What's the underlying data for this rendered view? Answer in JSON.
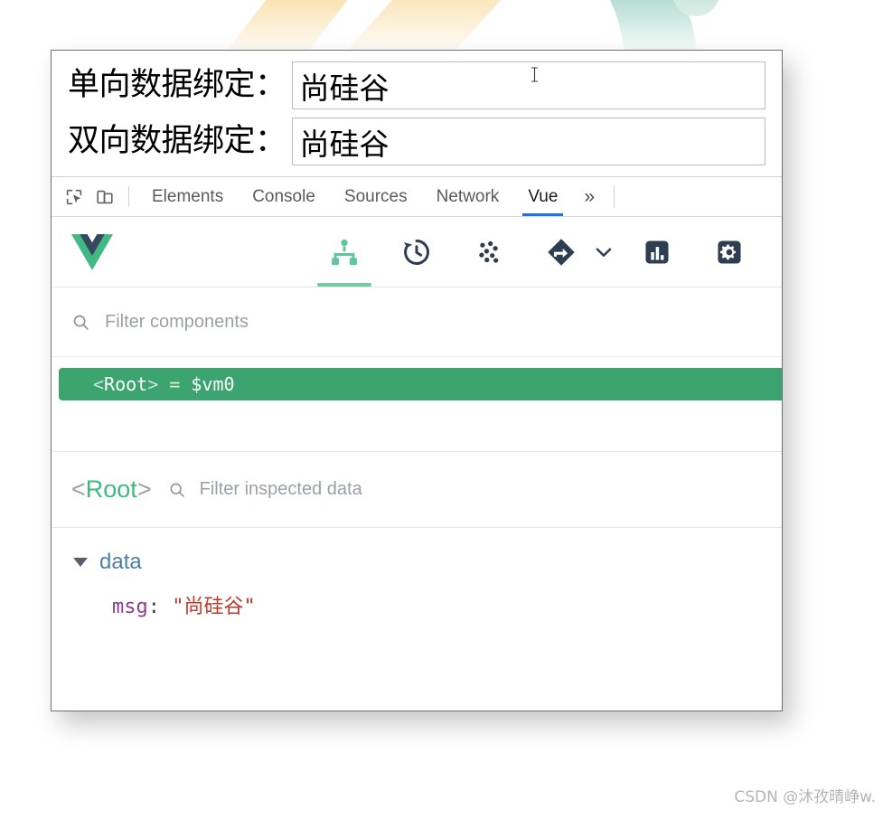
{
  "app": {
    "fields": [
      {
        "label": "单向数据绑定：",
        "value": "尚硅谷",
        "placeholder": ""
      },
      {
        "label": "双向数据绑定：",
        "value": "尚硅谷",
        "placeholder": ""
      }
    ]
  },
  "devtools": {
    "left_icons": [
      {
        "name": "inspect-element-icon"
      },
      {
        "name": "device-toolbar-icon"
      }
    ],
    "tabs": [
      {
        "label": "Elements",
        "active": false
      },
      {
        "label": "Console",
        "active": false
      },
      {
        "label": "Sources",
        "active": false
      },
      {
        "label": "Network",
        "active": false
      },
      {
        "label": "Vue",
        "active": true
      }
    ],
    "more_label": "»"
  },
  "vue_panel": {
    "logo": "vue-logo",
    "toolbar_buttons": [
      {
        "name": "components-tree-icon",
        "active": true
      },
      {
        "name": "timeline-history-icon",
        "active": false
      },
      {
        "name": "vuex-icon",
        "active": false
      },
      {
        "name": "routing-icon",
        "active": false
      },
      {
        "name": "performance-icon",
        "active": false
      },
      {
        "name": "settings-gear-icon",
        "active": false
      }
    ],
    "component_filter": {
      "value": "",
      "placeholder": "Filter components"
    },
    "tree": [
      {
        "open_bracket": "<",
        "name": "Root",
        "close_bracket": ">",
        "eq": " = ",
        "ref": "$vm0",
        "selected": true
      }
    ],
    "inspector": {
      "component_open": "<",
      "component_name": "Root",
      "component_close": ">",
      "filter": {
        "value": "",
        "placeholder": "Filter inspected data"
      },
      "groups": [
        {
          "label": "data",
          "expanded": true,
          "entries": [
            {
              "key": "msg",
              "colon": ": ",
              "quote": "\"",
              "value": "尚硅谷"
            }
          ]
        }
      ]
    }
  },
  "watermark": "CSDN @沐孜晴峥w.",
  "colors": {
    "vue_green": "#42b883",
    "vue_navy": "#35495e",
    "selection_green": "#3ba46f",
    "tab_active_blue": "#1a73e8",
    "string_red": "#c0392b",
    "key_purple": "#8b3d8b",
    "group_blue": "#4a7fa8",
    "deco_yellow": "#fae3b4",
    "deco_teal": "#b6ded3"
  }
}
